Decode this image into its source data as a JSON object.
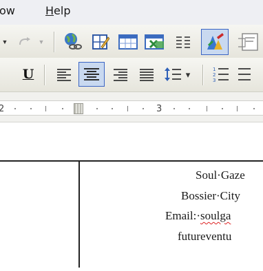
{
  "menu": {
    "view_partial": "ow",
    "help": "Help"
  },
  "toolbar1": {
    "items": [
      "undo-dropdown",
      "redo",
      "redo-dropdown",
      "hyperlink",
      "tables-borders",
      "insert-table",
      "insert-excel",
      "columns",
      "drawing"
    ]
  },
  "toolbar2": {
    "underline_label": "U",
    "line_spacing_dropdown": "▾"
  },
  "ruler": {
    "marker_3": "3",
    "marker_2": "2"
  },
  "document": {
    "line1": "Soul·Gaze",
    "line2": "Bossier·City",
    "line3_label": "Email:·",
    "line3_link": "soulga",
    "line4": "futureventu"
  },
  "colors": {
    "menubar_bg": "#eeeff3",
    "toolbar_bg": "#e9e8df",
    "active_button_bg": "#c9d9f0",
    "active_button_border": "#3a64c4",
    "spell_error": "#dd2222"
  }
}
